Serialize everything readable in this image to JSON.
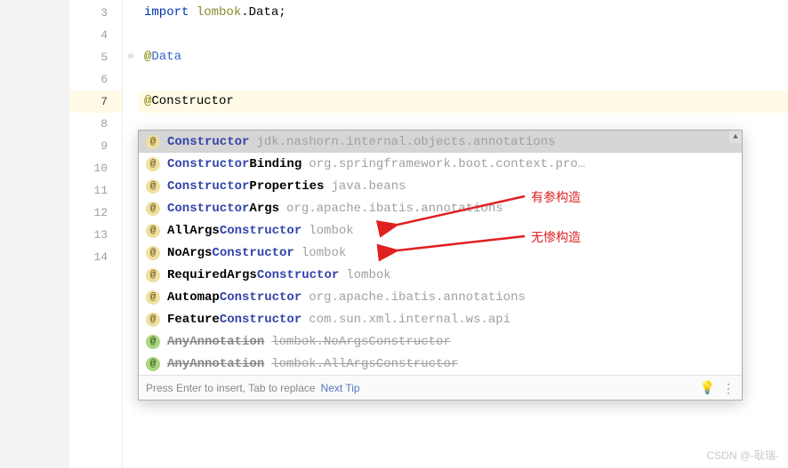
{
  "gutter": {
    "start": 3,
    "end": 14,
    "active": 7
  },
  "code": {
    "line3": {
      "kw": "import",
      "pkg1": "lombok",
      "dot": ".",
      "cls": "Data",
      "semi": ";"
    },
    "line5": {
      "at": "@",
      "name": "Data"
    },
    "line7": {
      "at": "@",
      "name": "Constructor"
    }
  },
  "suggestions": [
    {
      "icon": "@",
      "prefix": "",
      "match": "Constructor",
      "suffix": "",
      "tail": "jdk.nashorn.internal.objects.annotations",
      "selected": true
    },
    {
      "icon": "@",
      "prefix": "",
      "match": "Constructor",
      "suffix": "Binding",
      "tail": "org.springframework.boot.context.pro…"
    },
    {
      "icon": "@",
      "prefix": "",
      "match": "Constructor",
      "suffix": "Properties",
      "tail": "java.beans"
    },
    {
      "icon": "@",
      "prefix": "",
      "match": "Constructor",
      "suffix": "Args",
      "tail": "org.apache.ibatis.annotations"
    },
    {
      "icon": "@",
      "prefix": "AllArgs",
      "match": "Constructor",
      "suffix": "",
      "tail": "lombok"
    },
    {
      "icon": "@",
      "prefix": "NoArgs",
      "match": "Constructor",
      "suffix": "",
      "tail": "lombok"
    },
    {
      "icon": "@",
      "prefix": "RequiredArgs",
      "match": "Constructor",
      "suffix": "",
      "tail": "lombok"
    },
    {
      "icon": "@",
      "prefix": "Automap",
      "match": "Constructor",
      "suffix": "",
      "tail": "org.apache.ibatis.annotations"
    },
    {
      "icon": "@",
      "prefix": "Feature",
      "match": "Constructor",
      "suffix": "",
      "tail": "com.sun.xml.internal.ws.api"
    },
    {
      "icon": "@g",
      "prefix": "AnyAnnotation",
      "match": "",
      "suffix": "",
      "tail": "lombok.NoArgsConstructor",
      "strike": true
    },
    {
      "icon": "@g",
      "prefix": "AnyAnnotation",
      "match": "",
      "suffix": "",
      "tail": "lombok.AllArgsConstructor",
      "strike": true
    }
  ],
  "footer": {
    "hint": "Press Enter to insert, Tab to replace",
    "tip": "Next Tip"
  },
  "annotations": {
    "a1": "有参构造",
    "a2": "无惨构造"
  },
  "watermark": "CSDN @-耿瑞-"
}
